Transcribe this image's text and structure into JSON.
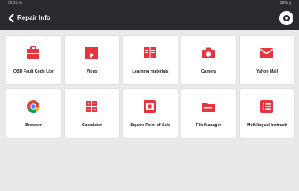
{
  "statusbar": {
    "time": "22:23 ✉ ↑",
    "battery": "58% ▮"
  },
  "header": {
    "title": "Repair Info"
  },
  "colors": {
    "accent": "#e8343e",
    "chrome": "#2a2a2e",
    "background": "#e9e9ea"
  },
  "tiles": [
    {
      "label": "OBD Fault Code Libr",
      "icon": "toolbox-icon"
    },
    {
      "label": "Video",
      "icon": "video-clapper-icon"
    },
    {
      "label": "Learning materials",
      "icon": "book-icon"
    },
    {
      "label": "Camera",
      "icon": "camera-icon"
    },
    {
      "label": "Yahoo Mail",
      "icon": "mail-icon"
    },
    {
      "label": "Browser",
      "icon": "chrome-browser-icon"
    },
    {
      "label": "Calculator",
      "icon": "calculator-icon"
    },
    {
      "label": "Square Point of Sale",
      "icon": "square-pos-icon"
    },
    {
      "label": "File Manager",
      "icon": "folder-icon"
    },
    {
      "label": "Multilingual Instructi",
      "icon": "list-document-icon"
    }
  ]
}
